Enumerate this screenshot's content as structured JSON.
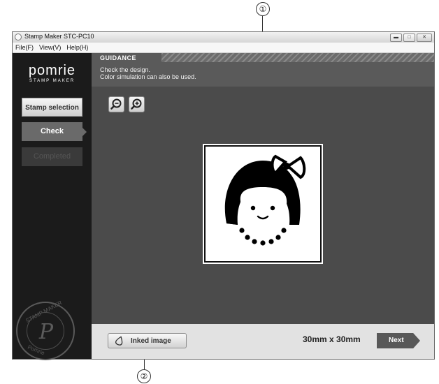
{
  "callouts": {
    "top": "①",
    "bottom": "②"
  },
  "window": {
    "title": "Stamp Maker STC-PC10",
    "controls": {
      "minimize": "▬",
      "maximize": "□",
      "close": "✕"
    }
  },
  "menu": [
    "File(F)",
    "View(V)",
    "Help(H)"
  ],
  "sidebar": {
    "logo": "pomrie",
    "logo_sub": "STAMP MAKER",
    "steps": [
      "Stamp selection",
      "Check",
      "Completed"
    ],
    "active_step": "Check",
    "seal": {
      "top": "STAMP MAKER",
      "letter": "P",
      "bottom": "Pomrie"
    }
  },
  "guidance": {
    "label": "GUIDANCE",
    "line1": "Check the design.",
    "line2": "Color simulation can also be used."
  },
  "toolbar": {
    "zoom_out_icon": "zoom-out-icon",
    "zoom_in_icon": "zoom-in-icon"
  },
  "footer": {
    "inked_label": "Inked image",
    "size": "30mm x 30mm",
    "next_label": "Next"
  },
  "colors": {
    "sidebar_bg": "#1b1b1b",
    "main_bg": "#4b4b4b",
    "guidance_bg": "#5a5a5a",
    "active_step": "#6a6a6a",
    "next_button": "#585858"
  }
}
